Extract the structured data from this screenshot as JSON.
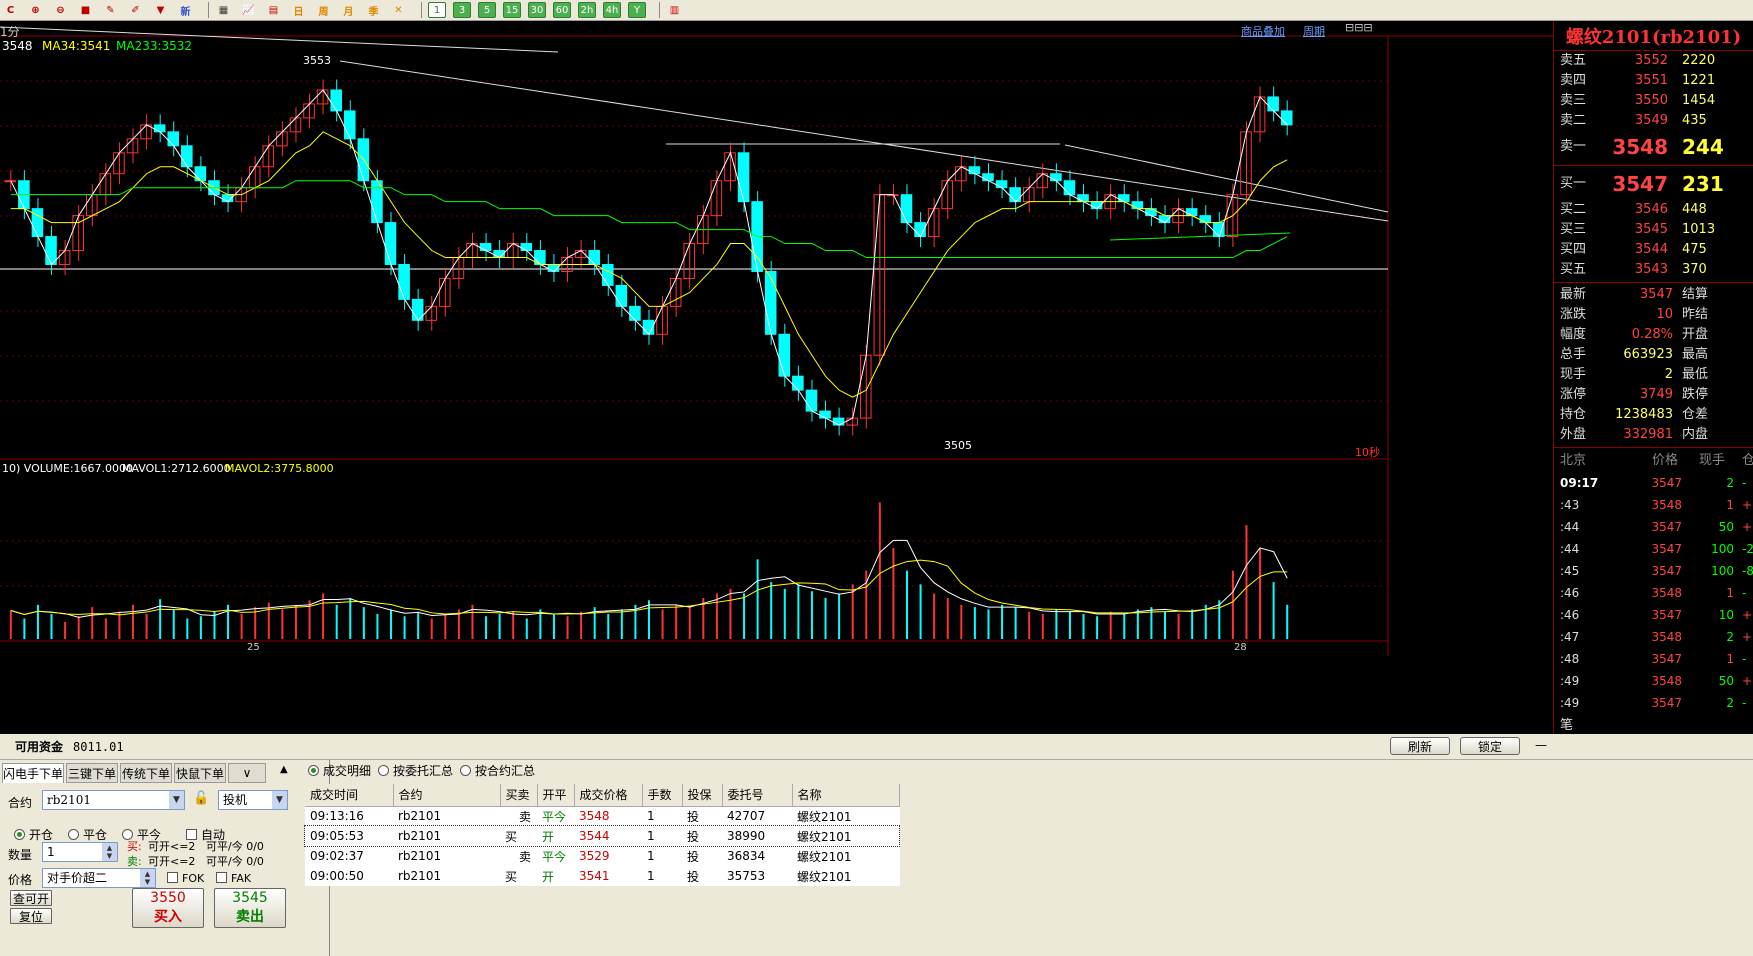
{
  "toolbar": {
    "icons": [
      "refresh-icon",
      "zoom-in-icon",
      "zoom-out-icon",
      "color-icon",
      "draw-icon",
      "eraser-icon",
      "filter-icon"
    ],
    "new_label": "新",
    "period_buttons": [
      "1",
      "3",
      "5",
      "15",
      "30",
      "60",
      "2h",
      "4h",
      "Y"
    ],
    "active_period": "1"
  },
  "chart": {
    "period_label": "1分",
    "ma_labels": [
      "3548",
      "MA34:3541",
      "MA233:3532"
    ],
    "ma_colors": [
      "#ffffff",
      "#ffff00",
      "#00ff00"
    ],
    "links": [
      "商品叠加",
      "周期"
    ],
    "high_label": "3553",
    "low_label": "3505",
    "interval_label": "10秒",
    "vol_labels": [
      "10) VOLUME:1667.0000",
      "MAVOL1:2712.6000",
      "MAVOL2:3775.8000"
    ],
    "date_labels": [
      "25",
      "28"
    ]
  },
  "quote": {
    "title": "螺纹2101(rb2101)",
    "asks": [
      {
        "label": "卖五",
        "price": "3552",
        "vol": "2220"
      },
      {
        "label": "卖四",
        "price": "3551",
        "vol": "1221"
      },
      {
        "label": "卖三",
        "price": "3550",
        "vol": "1454"
      },
      {
        "label": "卖二",
        "price": "3549",
        "vol": "435"
      },
      {
        "label": "卖一",
        "price": "3548",
        "vol": "244"
      }
    ],
    "bids": [
      {
        "label": "买一",
        "price": "3547",
        "vol": "231"
      },
      {
        "label": "买二",
        "price": "3546",
        "vol": "448"
      },
      {
        "label": "买三",
        "price": "3545",
        "vol": "1013"
      },
      {
        "label": "买四",
        "price": "3544",
        "vol": "475"
      },
      {
        "label": "买五",
        "price": "3543",
        "vol": "370"
      }
    ],
    "stats": [
      {
        "l1": "最新",
        "v": "3547",
        "l2": "结算",
        "y": false
      },
      {
        "l1": "涨跌",
        "v": "10",
        "l2": "昨结",
        "y": false
      },
      {
        "l1": "幅度",
        "v": "0.28%",
        "l2": "开盘",
        "y": false
      },
      {
        "l1": "总手",
        "v": "663923",
        "l2": "最高",
        "y": true
      },
      {
        "l1": "现手",
        "v": "2",
        "l2": "最低",
        "y": true
      },
      {
        "l1": "涨停",
        "v": "3749",
        "l2": "跌停",
        "y": false
      },
      {
        "l1": "持仓",
        "v": "1238483",
        "l2": "仓差",
        "y": true
      },
      {
        "l1": "外盘",
        "v": "332981",
        "l2": "内盘",
        "y": false
      }
    ],
    "tick_headers": [
      "北京",
      "价格",
      "现手",
      "仓差"
    ],
    "ticks": [
      {
        "t": "09:17",
        "p": "3547",
        "v": "2",
        "c": "-"
      },
      {
        "t": ":43",
        "p": "3548",
        "v": "1",
        "c": "+"
      },
      {
        "t": ":44",
        "p": "3547",
        "v": "50",
        "c": "+"
      },
      {
        "t": ":44",
        "p": "3547",
        "v": "100",
        "c": "-2"
      },
      {
        "t": ":45",
        "p": "3547",
        "v": "100",
        "c": "-8"
      },
      {
        "t": ":46",
        "p": "3548",
        "v": "1",
        "c": "-"
      },
      {
        "t": ":46",
        "p": "3547",
        "v": "10",
        "c": "+"
      },
      {
        "t": ":47",
        "p": "3548",
        "v": "2",
        "c": "+"
      },
      {
        "t": ":48",
        "p": "3547",
        "v": "1",
        "c": "-"
      },
      {
        "t": ":49",
        "p": "3548",
        "v": "50",
        "c": "+"
      },
      {
        "t": ":49",
        "p": "3547",
        "v": "2",
        "c": "-"
      }
    ],
    "footer": "笔"
  },
  "bottom": {
    "fund_label": "可用资金",
    "fund_value": "8011.01",
    "refresh": "刷新",
    "lock": "锁定",
    "tabs": [
      "闪电手下单",
      "三键下单",
      "传统下单",
      "快鼠下单"
    ],
    "contract_label": "合约",
    "contract_value": "rb2101",
    "hedge_value": "投机",
    "open_opts": [
      "开仓",
      "平仓",
      "平今"
    ],
    "auto_label": "自动",
    "qty_label": "数量",
    "qty_value": "1",
    "buy_info": "买:",
    "buy_open": "可开<=2",
    "buy_close": "可平/今 0/0",
    "sell_info": "卖:",
    "sell_open": "可开<=2",
    "sell_close": "可平/今 0/0",
    "price_label": "价格",
    "price_value": "对手价超二",
    "fok": "FOK",
    "fak": "FAK",
    "query_btn": "查可开",
    "reset_btn": "复位",
    "buy_price": "3550",
    "sell_price": "3545",
    "buy_btn": "买入",
    "sell_btn": "卖出",
    "fill_radios": [
      "成交明细",
      "按委托汇总",
      "按合约汇总"
    ],
    "headers": [
      "成交时间",
      "合约",
      "买卖",
      "开平",
      "成交价格",
      "手数",
      "投保",
      "委托号",
      "名称"
    ],
    "rows": [
      [
        "09:13:16",
        "rb2101",
        "卖",
        "平今",
        "3548",
        "1",
        "投",
        "42707",
        "螺纹2101"
      ],
      [
        "09:05:53",
        "rb2101",
        "买",
        "开",
        "3544",
        "1",
        "投",
        "38990",
        "螺纹2101"
      ],
      [
        "09:02:37",
        "rb2101",
        "卖",
        "平今",
        "3529",
        "1",
        "投",
        "36834",
        "螺纹2101"
      ],
      [
        "09:00:50",
        "rb2101",
        "买",
        "开",
        "3541",
        "1",
        "投",
        "35753",
        "螺纹2101"
      ]
    ]
  },
  "chart_data": {
    "type": "candlestick",
    "price_high": 3553,
    "price_low": 3505,
    "candles": [
      3540,
      3536,
      3532,
      3528,
      3530,
      3535,
      3538,
      3541,
      3544,
      3546,
      3548,
      3547,
      3545,
      3542,
      3540,
      3538,
      3537,
      3539,
      3542,
      3545,
      3547,
      3549,
      3551,
      3553,
      3550,
      3546,
      3540,
      3534,
      3528,
      3523,
      3520,
      3522,
      3526,
      3529,
      3531,
      3530,
      3529,
      3531,
      3530,
      3528,
      3527,
      3529,
      3530,
      3528,
      3525,
      3522,
      3520,
      3518,
      3522,
      3526,
      3531,
      3535,
      3540,
      3544,
      3537,
      3527,
      3518,
      3512,
      3510,
      3507,
      3506,
      3505,
      3506,
      3515,
      3538,
      3538,
      3534,
      3532,
      3536,
      3540,
      3542,
      3541,
      3540,
      3539,
      3537,
      3539,
      3541,
      3540,
      3538,
      3537,
      3536,
      3538,
      3537,
      3536,
      3535,
      3534,
      3536,
      3535,
      3534,
      3532,
      3538,
      3547,
      3552,
      3550,
      3548
    ],
    "ma34": [
      3536,
      3536,
      3535,
      3534,
      3534,
      3534,
      3535,
      3536,
      3537,
      3539,
      3541,
      3542,
      3542,
      3541,
      3540,
      3539,
      3538,
      3538,
      3539,
      3540,
      3542,
      3544,
      3545,
      3547,
      3546,
      3545,
      3543,
      3540,
      3537,
      3534,
      3532,
      3530,
      3529,
      3529,
      3529,
      3529,
      3529,
      3529,
      3529,
      3528,
      3528,
      3528,
      3528,
      3528,
      3527,
      3526,
      3524,
      3522,
      3522,
      3523,
      3524,
      3526,
      3528,
      3531,
      3531,
      3529,
      3526,
      3522,
      3518,
      3515,
      3512,
      3510,
      3509,
      3510,
      3514,
      3518,
      3521,
      3524,
      3527,
      3530,
      3532,
      3534,
      3535,
      3536,
      3536,
      3537,
      3537,
      3537,
      3537,
      3537,
      3537,
      3537,
      3537,
      3536,
      3536,
      3535,
      3535,
      3535,
      3534,
      3534,
      3535,
      3537,
      3540,
      3542,
      3543
    ],
    "ma233": [
      3538,
      3538,
      3538,
      3538,
      3538,
      3538,
      3538,
      3538,
      3538,
      3539,
      3539,
      3539,
      3539,
      3539,
      3539,
      3539,
      3539,
      3539,
      3539,
      3539,
      3539,
      3540,
      3540,
      3540,
      3540,
      3540,
      3539,
      3539,
      3539,
      3538,
      3538,
      3538,
      3537,
      3537,
      3537,
      3537,
      3536,
      3536,
      3536,
      3536,
      3535,
      3535,
      3535,
      3535,
      3535,
      3534,
      3534,
      3534,
      3534,
      3534,
      3533,
      3533,
      3533,
      3533,
      3533,
      3532,
      3532,
      3531,
      3531,
      3531,
      3530,
      3530,
      3530,
      3529,
      3529,
      3529,
      3529,
      3529,
      3529,
      3529,
      3529,
      3529,
      3529,
      3529,
      3529,
      3529,
      3529,
      3529,
      3529,
      3529,
      3529,
      3529,
      3529,
      3529,
      3529,
      3529,
      3529,
      3529,
      3529,
      3529,
      3529,
      3530,
      3530,
      3531,
      3532
    ],
    "volumes": [
      25,
      18,
      30,
      22,
      15,
      20,
      28,
      18,
      24,
      30,
      22,
      35,
      26,
      18,
      20,
      24,
      30,
      22,
      28,
      32,
      26,
      30,
      34,
      40,
      30,
      36,
      28,
      22,
      26,
      20,
      24,
      18,
      22,
      26,
      30,
      20,
      22,
      24,
      18,
      26,
      22,
      20,
      24,
      28,
      22,
      26,
      30,
      34,
      26,
      30,
      28,
      36,
      40,
      44,
      40,
      70,
      50,
      44,
      48,
      42,
      36,
      40,
      48,
      60,
      120,
      80,
      60,
      48,
      40,
      36,
      30,
      28,
      26,
      30,
      28,
      24,
      22,
      26,
      24,
      22,
      20,
      24,
      22,
      26,
      28,
      24,
      22,
      26,
      30,
      34,
      60,
      100,
      80,
      50,
      30
    ]
  }
}
